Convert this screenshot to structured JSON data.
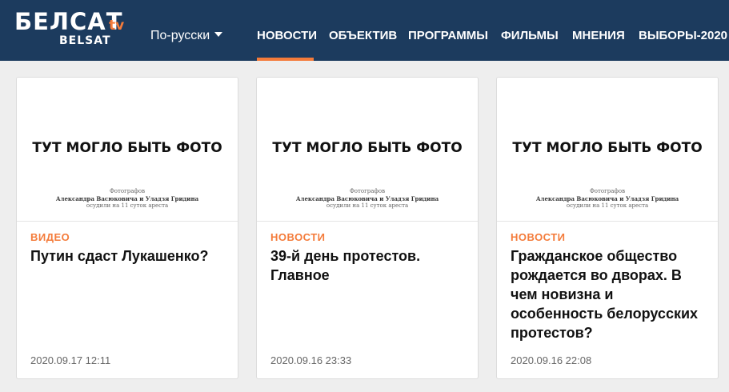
{
  "header": {
    "logo": {
      "main": "БЕЛСАТ",
      "tv": "tv",
      "sub": "BELSAT"
    },
    "language": "По-русски",
    "nav": [
      {
        "label": "НОВОСТИ",
        "active": true
      },
      {
        "label": "ОБЪЕКТИВ"
      },
      {
        "label": "ПРОГРАММЫ"
      },
      {
        "label": "ФИЛЬМЫ"
      },
      {
        "label": "МНЕНИЯ"
      },
      {
        "label": "ВЫБОРЫ-2020"
      }
    ],
    "colors": {
      "background": "#1c3b5e",
      "accent": "#f47b3a"
    }
  },
  "placeholder": {
    "title": "ТУТ МОГЛО БЫТЬ ФОТО",
    "caption1": "Фотографов",
    "caption2": "Александра Васюковича и Уладзя Гридина",
    "caption3": "осудили на 11 суток ареста"
  },
  "cards": [
    {
      "category": "ВИДЕО",
      "headline": "Путин сдаст Лукашенко?",
      "date": "2020.09.17 12:11"
    },
    {
      "category": "НОВОСТИ",
      "headline": "39-й день протестов. Главное",
      "date": "2020.09.16 23:33"
    },
    {
      "category": "НОВОСТИ",
      "headline": "Гражданское общество рождается во дворах. В чем новизна и особенность белорусских протестов?",
      "date": "2020.09.16 22:08"
    }
  ]
}
